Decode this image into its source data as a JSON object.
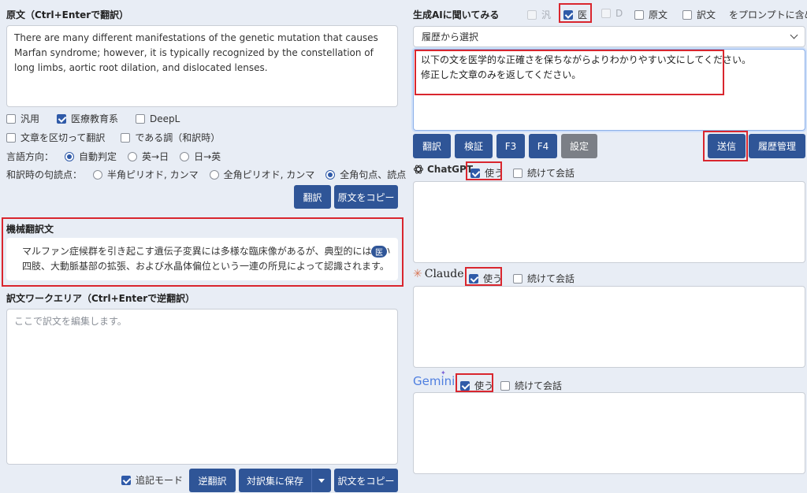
{
  "left": {
    "source_title": "原文（Ctrl+Enterで翻訳）",
    "source_text": "There are many different manifestations of the genetic mutation that causes Marfan syndrome; however, it is typically recognized by the constellation of long limbs, aortic root dilation, and dislocated lenses.",
    "engine_options": [
      {
        "label": "汎用",
        "checked": false
      },
      {
        "label": "医療教育系",
        "checked": true
      },
      {
        "label": "DeepL",
        "checked": false
      }
    ],
    "opt_split": "文章を区切って翻訳",
    "opt_dearu": "である調（和訳時）",
    "direction_label": "言語方向：",
    "direction_options": [
      "自動判定",
      "英→日",
      "日→英"
    ],
    "punct_label": "和訳時の句読点：",
    "punct_options": [
      "半角ピリオド, カンマ",
      "全角ピリオド, カンマ",
      "全角句点、読点"
    ],
    "btn_translate": "翻訳",
    "btn_copy_source": "原文をコピー",
    "mt_title": "機械翻訳文",
    "mt_text_1": "マルファン症候群を引き起こす遺伝子変異には多様な臨床像があるが、典型的には長い",
    "mt_text_2": "四肢、大動脈基部の拡張、および水晶体偏位という一連の所見によって認識されます。",
    "mt_badge": "医",
    "work_title": "訳文ワークエリア（Ctrl+Enterで逆翻訳）",
    "work_placeholder": "ここで訳文を編集します。",
    "opt_append": "追記モード",
    "btn_back_translate": "逆翻訳",
    "btn_save": "対訳集に保存",
    "btn_copy_target": "訳文をコピー"
  },
  "right": {
    "ai_title": "生成AIに聞いてみる",
    "prompt_flags": [
      {
        "label": "汎",
        "checked": false,
        "disabled": true
      },
      {
        "label": "医",
        "checked": true,
        "disabled": false
      },
      {
        "label": "D",
        "checked": false,
        "disabled": true
      },
      {
        "label": "原文",
        "checked": false,
        "disabled": false
      },
      {
        "label": "訳文",
        "checked": false,
        "disabled": false
      }
    ],
    "include_label": "をプロンプトに含める",
    "history_select": "履歴から選択",
    "prompt_line_1": "以下の文を医学的な正確さを保ちながらよりわかりやすい文にしてください。",
    "prompt_line_2": "修正した文章のみを返してください。",
    "btn_translate": "翻訳",
    "btn_verify": "検証",
    "btn_f3": "F3",
    "btn_f4": "F4",
    "btn_settings": "設定",
    "btn_send": "送信",
    "btn_history": "履歴管理",
    "models": [
      {
        "name": "ChatGPT",
        "use": "使う",
        "continue": "続けて会話"
      },
      {
        "name": "Claude",
        "use": "使う",
        "continue": "続けて会話"
      },
      {
        "name": "Gemini",
        "use": "使う",
        "continue": "続けて会話"
      }
    ]
  }
}
